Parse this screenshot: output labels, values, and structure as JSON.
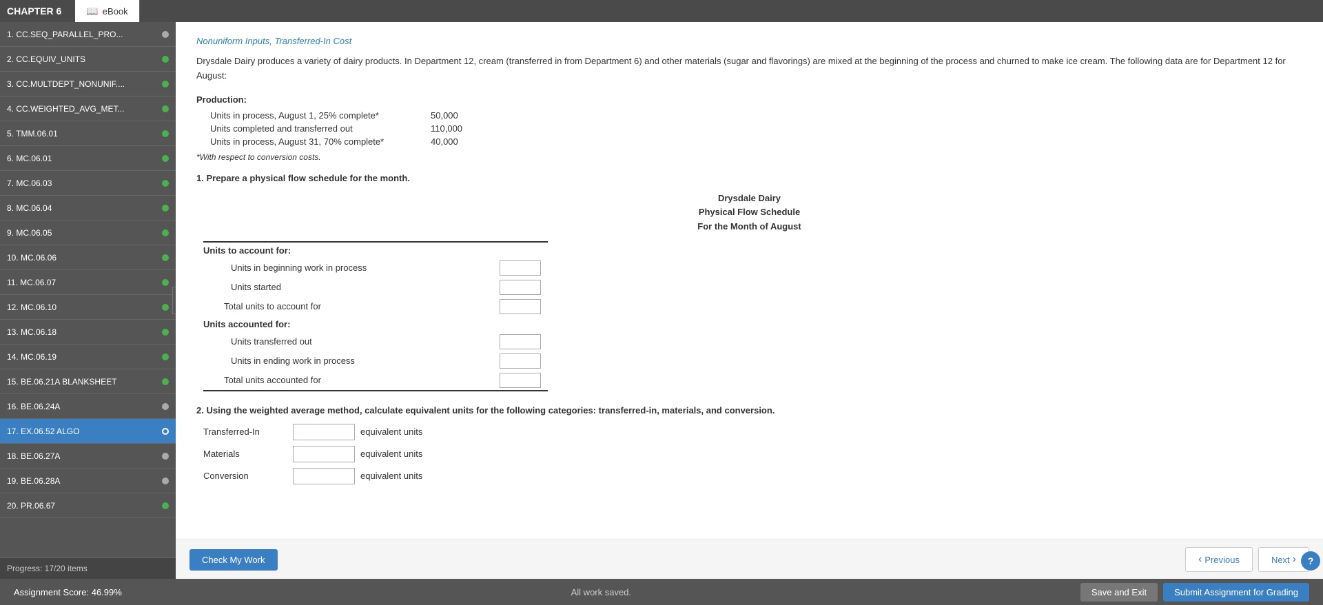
{
  "topBar": {
    "chapterTitle": "CHAPTER 6",
    "tabs": [
      {
        "id": "ebook",
        "label": "eBook",
        "icon": "📖",
        "active": true
      }
    ]
  },
  "sidebar": {
    "items": [
      {
        "id": 1,
        "label": "1. CC.SEQ_PARALLEL_PRO...",
        "dotClass": "dot-gray",
        "active": false
      },
      {
        "id": 2,
        "label": "2. CC.EQUIV_UNITS",
        "dotClass": "dot-green",
        "active": false
      },
      {
        "id": 3,
        "label": "3. CC.MULTDEPT_NONUNIF....",
        "dotClass": "dot-green",
        "active": false
      },
      {
        "id": 4,
        "label": "4. CC.WEIGHTED_AVG_MET...",
        "dotClass": "dot-green",
        "active": false
      },
      {
        "id": 5,
        "label": "5. TMM.06.01",
        "dotClass": "dot-green",
        "active": false
      },
      {
        "id": 6,
        "label": "6. MC.06.01",
        "dotClass": "dot-green",
        "active": false
      },
      {
        "id": 7,
        "label": "7. MC.06.03",
        "dotClass": "dot-green",
        "active": false
      },
      {
        "id": 8,
        "label": "8. MC.06.04",
        "dotClass": "dot-green",
        "active": false
      },
      {
        "id": 9,
        "label": "9. MC.06.05",
        "dotClass": "dot-green",
        "active": false
      },
      {
        "id": 10,
        "label": "10. MC.06.06",
        "dotClass": "dot-green",
        "active": false
      },
      {
        "id": 11,
        "label": "11. MC.06.07",
        "dotClass": "dot-green",
        "active": false
      },
      {
        "id": 12,
        "label": "12. MC.06.10",
        "dotClass": "dot-green",
        "active": false
      },
      {
        "id": 13,
        "label": "13. MC.06.18",
        "dotClass": "dot-green",
        "active": false
      },
      {
        "id": 14,
        "label": "14. MC.06.19",
        "dotClass": "dot-green",
        "active": false
      },
      {
        "id": 15,
        "label": "15. BE.06.21A BLANKSHEET",
        "dotClass": "dot-green",
        "active": false
      },
      {
        "id": 16,
        "label": "16. BE.06.24A",
        "dotClass": "dot-gray",
        "active": false
      },
      {
        "id": 17,
        "label": "17. EX.06.52 ALGO",
        "dotClass": "dot-blue",
        "active": true
      },
      {
        "id": 18,
        "label": "18. BE.06.27A",
        "dotClass": "dot-gray",
        "active": false
      },
      {
        "id": 19,
        "label": "19. BE.06.28A",
        "dotClass": "dot-gray",
        "active": false
      },
      {
        "id": 20,
        "label": "20. PR.06.67",
        "dotClass": "dot-green",
        "active": false
      }
    ],
    "progress": "Progress: 17/20 items"
  },
  "content": {
    "subtitle": "Nonuniform Inputs, Transferred-In Cost",
    "description": "Drysdale Dairy produces a variety of dairy products. In Department 12, cream (transferred in from Department 6) and other materials (sugar and flavorings) are mixed at the beginning of the process and churned to make ice cream. The following data are for Department 12 for August:",
    "productionHeader": "Production:",
    "productionRows": [
      {
        "label": "Units in process, August 1, 25% complete*",
        "value": "50,000"
      },
      {
        "label": "Units completed and transferred out",
        "value": "110,000"
      },
      {
        "label": "Units in process, August 31, 70% complete*",
        "value": "40,000"
      }
    ],
    "footnote": "*With respect to conversion costs.",
    "question1": {
      "number": "1.",
      "text": "Prepare a physical flow schedule for the month.",
      "tableHeader": {
        "line1": "Drysdale Dairy",
        "line2": "Physical Flow Schedule",
        "line3": "For the Month of August"
      },
      "toAccountFor": {
        "sectionLabel": "Units to account for:",
        "rows": [
          {
            "label": "Units in beginning work in process",
            "inputId": "beginning-wip"
          },
          {
            "label": "Units started",
            "inputId": "units-started"
          },
          {
            "label": "Total units to account for",
            "inputId": "total-to-account",
            "isTotal": true
          }
        ]
      },
      "accountedFor": {
        "sectionLabel": "Units accounted for:",
        "rows": [
          {
            "label": "Units transferred out",
            "inputId": "units-transferred"
          },
          {
            "label": "Units in ending work in process",
            "inputId": "ending-wip"
          },
          {
            "label": "Total units accounted for",
            "inputId": "total-accounted",
            "isTotal": true
          }
        ]
      }
    },
    "question2": {
      "number": "2.",
      "text": "Using the weighted average method, calculate equivalent units for the following categories: transferred-in, materials, and conversion.",
      "rows": [
        {
          "label": "Transferred-In",
          "inputId": "transferred-in-eu",
          "suffix": "equivalent units"
        },
        {
          "label": "Materials",
          "inputId": "materials-eu",
          "suffix": "equivalent units"
        },
        {
          "label": "Conversion",
          "inputId": "conversion-eu",
          "suffix": "equivalent units"
        }
      ]
    }
  },
  "bottomBar": {
    "checkMyWorkLabel": "Check My Work",
    "previousLabel": "Previous",
    "nextLabel": "Next"
  },
  "footer": {
    "assignmentScore": "Assignment Score:  46.99%",
    "allWorkSaved": "All work saved.",
    "saveExitLabel": "Save and Exit",
    "submitLabel": "Submit Assignment for Grading"
  },
  "help": {
    "questionMark": "?"
  }
}
